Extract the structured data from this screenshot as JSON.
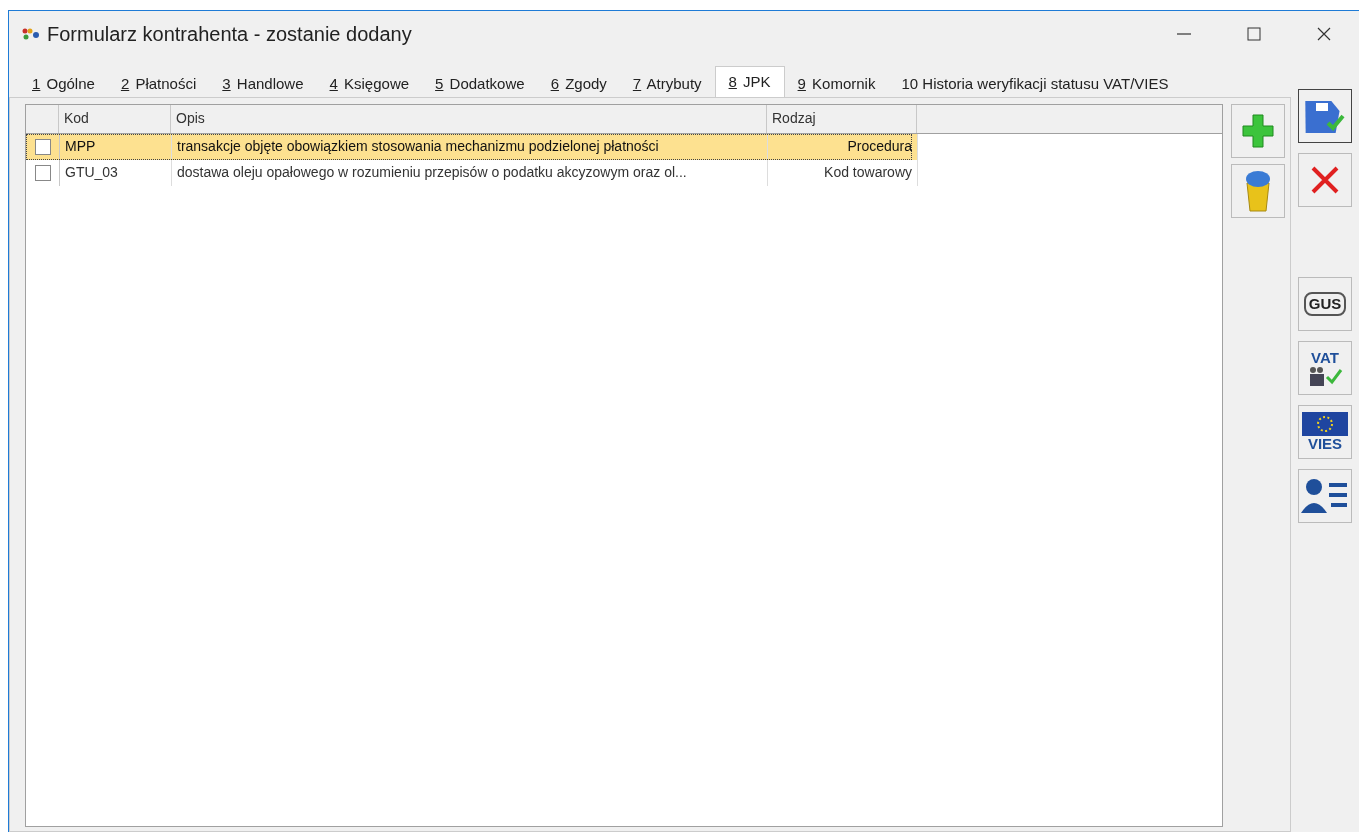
{
  "window": {
    "title": "Formularz kontrahenta - zostanie dodany"
  },
  "tabs": [
    {
      "key": "1",
      "label": "Ogólne",
      "access_key": true,
      "selected": false
    },
    {
      "key": "2",
      "label": "Płatności",
      "access_key": true,
      "selected": false
    },
    {
      "key": "3",
      "label": "Handlowe",
      "access_key": true,
      "selected": false
    },
    {
      "key": "4",
      "label": "Księgowe",
      "access_key": true,
      "selected": false
    },
    {
      "key": "5",
      "label": "Dodatkowe",
      "access_key": true,
      "selected": false
    },
    {
      "key": "6",
      "label": "Zgody",
      "access_key": true,
      "selected": false
    },
    {
      "key": "7",
      "label": "Atrybuty",
      "access_key": true,
      "selected": false
    },
    {
      "key": "8",
      "label": "JPK",
      "access_key": true,
      "selected": true
    },
    {
      "key": "9",
      "label": "Komornik",
      "access_key": true,
      "selected": false
    },
    {
      "key": "10",
      "label": "Historia weryfikacji statusu VAT/VIES",
      "access_key": false,
      "selected": false
    }
  ],
  "table": {
    "columns": [
      "Kod",
      "Opis",
      "Rodzaj"
    ],
    "rows": [
      {
        "checked": false,
        "selected": true,
        "cells": [
          "MPP",
          "transakcje objęte obowiązkiem stosowania mechanizmu podzielonej płatności",
          "Procedura"
        ]
      },
      {
        "checked": false,
        "selected": false,
        "cells": [
          "GTU_03",
          "dostawa oleju opałowego w rozumieniu przepisów o podatku akcyzowym oraz ol...",
          "Kod towarowy"
        ]
      }
    ]
  },
  "list_buttons": [
    {
      "kind": "add"
    },
    {
      "kind": "delete"
    }
  ],
  "side_buttons": [
    {
      "kind": "save",
      "focused": true
    },
    {
      "kind": "cancel",
      "focused": false
    },
    {
      "kind": "gap"
    },
    {
      "kind": "gus",
      "text": "GUS",
      "focused": false
    },
    {
      "kind": "vat",
      "text": "VAT",
      "focused": false
    },
    {
      "kind": "vies",
      "text": "VIES",
      "focused": false
    },
    {
      "kind": "person",
      "focused": false
    }
  ]
}
